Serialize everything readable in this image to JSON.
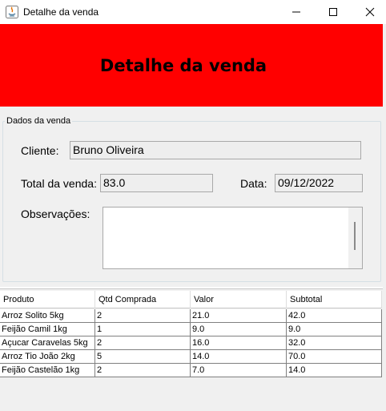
{
  "window": {
    "title": "Detalhe da venda"
  },
  "header": {
    "title": "Detalhe da venda",
    "background": "#ff0000"
  },
  "form": {
    "group_title": "Dados da venda",
    "cliente_label": "Cliente:",
    "cliente_value": "Bruno Oliveira",
    "total_label": "Total da venda:",
    "total_value": "83.0",
    "data_label": "Data:",
    "data_value": "09/12/2022",
    "observacoes_label": "Observações:",
    "observacoes_value": ""
  },
  "table": {
    "columns": [
      "Produto",
      "Qtd Comprada",
      "Valor",
      "Subtotal"
    ],
    "rows": [
      [
        "Arroz Solito 5kg",
        "2",
        "21.0",
        "42.0"
      ],
      [
        "Feijão Camil 1kg",
        "1",
        "9.0",
        "9.0"
      ],
      [
        "Açucar Caravelas 5kg",
        "2",
        "16.0",
        "32.0"
      ],
      [
        "Arroz Tio João 2kg",
        "5",
        "14.0",
        "70.0"
      ],
      [
        "Feijão Castelão 1kg",
        "2",
        "7.0",
        "14.0"
      ]
    ]
  }
}
